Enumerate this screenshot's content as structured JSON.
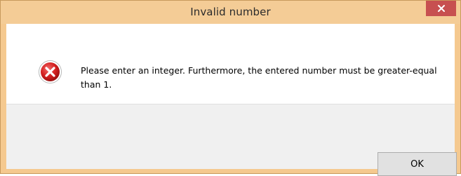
{
  "window": {
    "title": "Invalid number",
    "close_icon": "close-icon"
  },
  "dialog": {
    "icon": "error-icon",
    "message": "Please enter an integer. Furthermore, the entered number must be greater-equal than 1.",
    "ok_label": "OK"
  },
  "colors": {
    "titlebar": "#f4cc96",
    "close_button": "#c75050",
    "error_red": "#d42020",
    "footer": "#f0f0f0"
  }
}
